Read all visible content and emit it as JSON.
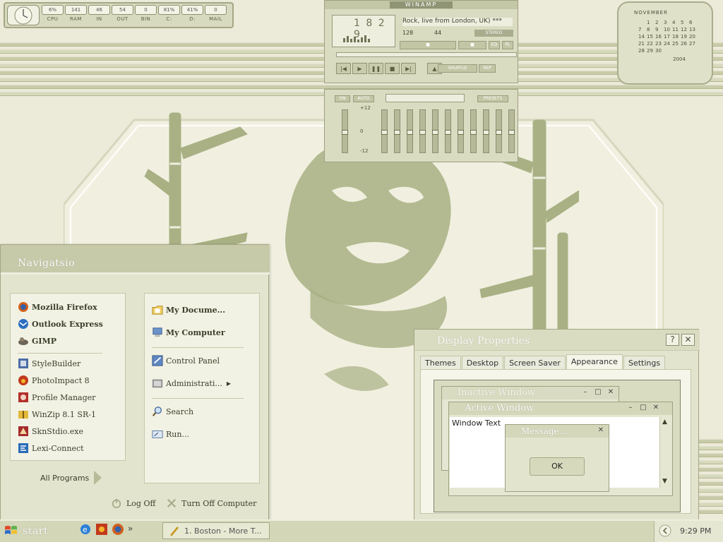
{
  "stats": {
    "items": [
      {
        "label": "CPU",
        "value": "6%"
      },
      {
        "label": "RAM",
        "value": "141"
      },
      {
        "label": "IN",
        "value": "46"
      },
      {
        "label": "OUT",
        "value": "54"
      },
      {
        "label": "BIN",
        "value": "0"
      },
      {
        "label": "C:",
        "value": "81%"
      },
      {
        "label": "D:",
        "value": "41%"
      },
      {
        "label": "MAIL",
        "value": "0"
      }
    ]
  },
  "calendar": {
    "month": "NOVEMBER",
    "year": "2004",
    "days": [
      "1",
      "2",
      "3",
      "4",
      "5",
      "6",
      "7",
      "8",
      "9",
      "10",
      "11",
      "12",
      "13",
      "14",
      "15",
      "16",
      "17",
      "18",
      "19",
      "20",
      "21",
      "22",
      "23",
      "24",
      "25",
      "26",
      "27",
      "28",
      "29",
      "30"
    ]
  },
  "winamp": {
    "title": "WINAMP",
    "time": "1 8 2 9",
    "song": "Rock, live from London, UK) ***",
    "kbps": "128",
    "khz": "44",
    "stereo": "STEREO",
    "eq_toggle": "EQ",
    "pl_toggle": "PL",
    "shuffle": "SHUFFLE",
    "repeat": "REP",
    "eq": {
      "on": "ON",
      "auto": "AUTO",
      "presets": "PRESETS",
      "scale_top": "+12",
      "scale_mid": "0",
      "scale_bottom": "-12",
      "levels": [
        0.5,
        0.5,
        0.5,
        0.5,
        0.5,
        0.5,
        0.5,
        0.5,
        0.5,
        0.5,
        0.5,
        0.5
      ]
    }
  },
  "start_menu": {
    "header": "Navigatsio",
    "pinned": [
      {
        "label": "Mozilla Firefox",
        "icon": "firefox-icon"
      },
      {
        "label": "Outlook Express",
        "icon": "outlook-icon"
      },
      {
        "label": "GIMP",
        "icon": "gimp-icon"
      }
    ],
    "recent": [
      {
        "label": "StyleBuilder",
        "icon": "stylebuilder-icon"
      },
      {
        "label": "PhotoImpact 8",
        "icon": "photoimpact-icon"
      },
      {
        "label": "Profile Manager",
        "icon": "profile-manager-icon"
      },
      {
        "label": "WinZip 8.1 SR-1",
        "icon": "winzip-icon"
      },
      {
        "label": "SknStdio.exe",
        "icon": "skinstudio-icon"
      },
      {
        "label": "Lexi-Connect",
        "icon": "lexi-connect-icon"
      }
    ],
    "right_top": [
      {
        "label": "My Docume...",
        "icon": "my-documents-icon"
      },
      {
        "label": "My Computer",
        "icon": "my-computer-icon"
      }
    ],
    "right_mid": [
      {
        "label": "Control Panel",
        "icon": "control-panel-icon"
      },
      {
        "label": "Administrati...",
        "icon": "admin-tools-icon"
      }
    ],
    "right_bottom": [
      {
        "label": "Search",
        "icon": "search-icon"
      },
      {
        "label": "Run...",
        "icon": "run-icon"
      }
    ],
    "all_programs": "All Programs",
    "log_off": "Log Off",
    "turn_off": "Turn Off Computer"
  },
  "display_properties": {
    "title": "Display Properties",
    "tabs": [
      "Themes",
      "Desktop",
      "Screen Saver",
      "Appearance",
      "Settings"
    ],
    "active_tab": "Appearance",
    "preview": {
      "inactive": "Inactive Window",
      "active": "Active Window",
      "window_text": "Window Text",
      "message": "Message...",
      "ok": "OK"
    }
  },
  "taskbar": {
    "start": "start",
    "task": "1. Boston - More T...",
    "overflow": "»",
    "clock": "9:29 PM"
  },
  "colors": {
    "desktop": "#ecead8",
    "bamboo": "#a9b184",
    "panel": "#e2e4cd",
    "accent": "#c7caa9"
  }
}
